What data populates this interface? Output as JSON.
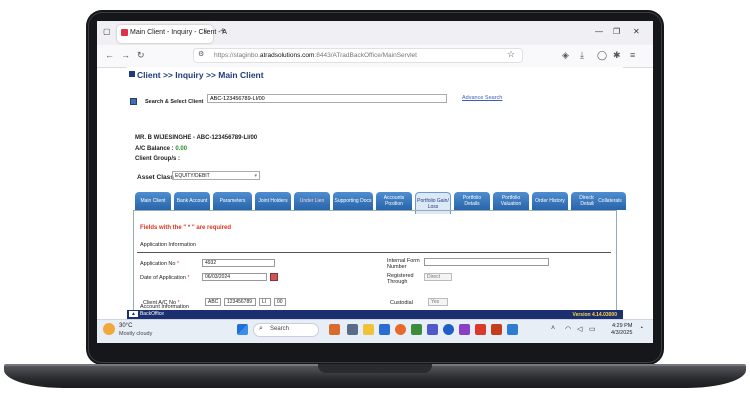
{
  "browser": {
    "tab_title": "Main Client - Inquiry - Client - A",
    "tab_close": "×",
    "new_tab": "+",
    "url_prefix": "https://staginbo.",
    "url_domain": "atradsolutions.com",
    "url_suffix": ":8443/ATradBackOffice/MainServlet"
  },
  "page": {
    "breadcrumb": "Client >> Inquiry >> Main Client",
    "search_label": "Search & Select Client",
    "search_value": "ABC-123456789-LI/00",
    "advanced_search": "Advance Search",
    "client_name": "MR. B WIJESINGHE - ABC-123456789-LI/00",
    "balance_label": "A/C Balance : ",
    "balance_value": "0.00",
    "client_groups_label": "Client Group/s :",
    "asset_class_label": "Asset Class",
    "asset_class_value": "EQUITY/DEBIT",
    "tabs": [
      {
        "label": "Main Client"
      },
      {
        "label": "Bank Account"
      },
      {
        "label": "Parameters"
      },
      {
        "label": "Joint Holders"
      },
      {
        "label": "Under Lien"
      },
      {
        "label": "Supporting Docs"
      },
      {
        "label": "Accounts Position"
      },
      {
        "label": "Portfolio Gain/ Loss"
      },
      {
        "label": "Portfolio Details"
      },
      {
        "label": "Portfolio Valuation"
      },
      {
        "label": "Order History"
      },
      {
        "label": "Director Details"
      },
      {
        "label": "Collaterals"
      }
    ],
    "required_note": "Fields with the \" * \" are required",
    "app_info_title": "Application Information",
    "application_no_label": "Application No",
    "application_no_value": "4932",
    "date_label": "Date of Application",
    "date_value": "06/03/2024",
    "internal_form_label": "Internal Form Number",
    "registered_through_label": "Registered Through",
    "registered_through_value": "Direct",
    "account_info_title": "Account Information",
    "client_ac_label": "Client A/C No",
    "client_ac_part1": "ABC",
    "client_ac_part2": "123456789",
    "client_ac_part3": "LI",
    "client_ac_part4": "00",
    "custodial_label": "Custodial",
    "custodial_value": "Yes",
    "star": "*",
    "footer_brand": "BackOffice",
    "footer_version": "Version 4.14.03000"
  },
  "taskbar": {
    "weather_temp": "30°C",
    "weather_desc": "Mostly cloudy",
    "search_placeholder": "Search",
    "time": "4:29 PM",
    "date": "4/3/2025"
  }
}
